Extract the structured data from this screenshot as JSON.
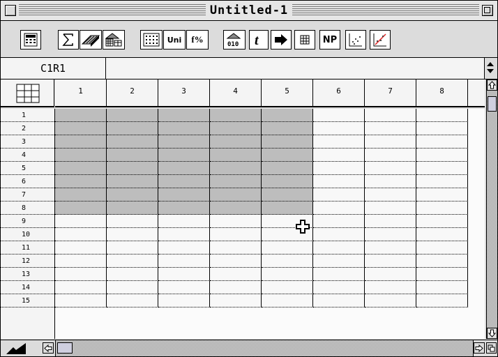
{
  "window": {
    "title": "Untitled-1"
  },
  "toolbar": {
    "uni_label": "Uni",
    "format_label": "f%",
    "np_label": "NP"
  },
  "formula_bar": {
    "cell_reference": "C1R1",
    "formula": ""
  },
  "grid": {
    "column_headers": [
      "1",
      "2",
      "3",
      "4",
      "5",
      "6",
      "7",
      "8"
    ],
    "row_headers": [
      "1",
      "2",
      "3",
      "4",
      "5",
      "6",
      "7",
      "8",
      "9",
      "10",
      "11",
      "12",
      "13",
      "14",
      "15"
    ],
    "selection": {
      "from_col": 1,
      "to_col": 5,
      "from_row": 1,
      "to_row": 8
    }
  },
  "colors": {
    "selection": "#bdbdbd",
    "cell_background": "#f8f8f8",
    "chrome": "#dcdcdc"
  }
}
